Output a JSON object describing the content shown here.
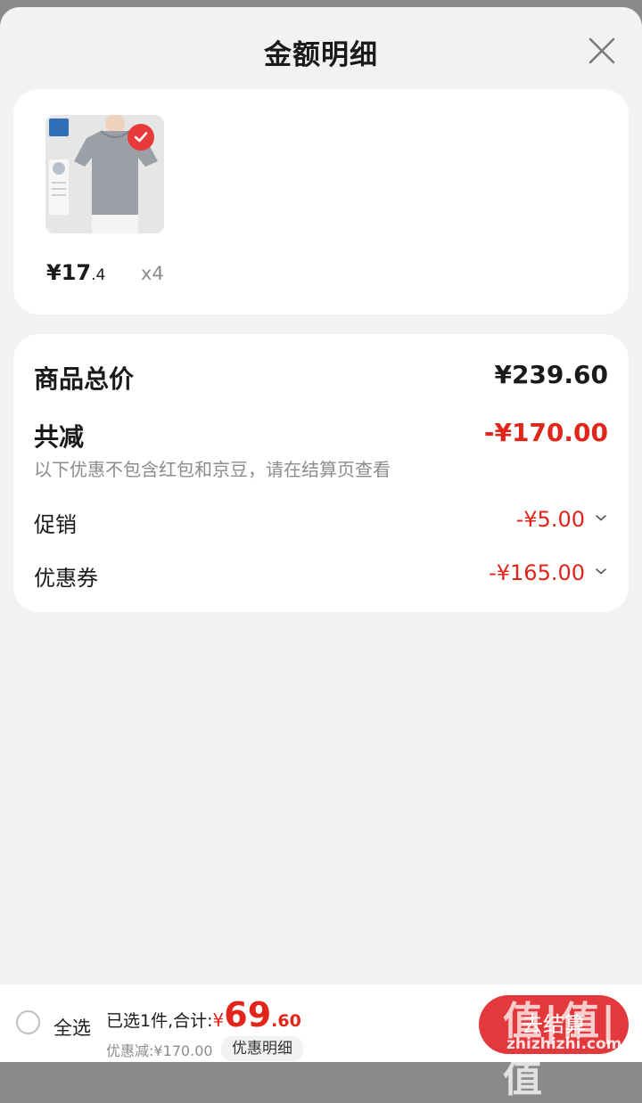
{
  "sheet": {
    "title": "金额明细",
    "close_icon": "close-icon"
  },
  "item": {
    "price_int": "¥17",
    "price_dec": ".4",
    "quantity": "x4",
    "thumbnail_icon": "product-thumbnail-tshirt",
    "selected": true
  },
  "detail": {
    "total_label": "商品总价",
    "total_value": "¥239.60",
    "reduce_label": "共减",
    "reduce_value": "-¥170.00",
    "note": "以下优惠不包含红包和京豆，请在结算页查看",
    "promo_label": "促销",
    "promo_value": "-¥5.00",
    "coupon_label": "优惠券",
    "coupon_value": "-¥165.00"
  },
  "bottom": {
    "select_all": "全选",
    "selected_text": "已选1件,合计:",
    "yen": "¥",
    "total_int": "69",
    "total_dec": ".60",
    "discount_text": "优惠减:¥170.00",
    "detail_button": "优惠明细",
    "checkout_button": "去结算"
  },
  "watermark": {
    "big": "值|值|值",
    "small": "zhizhizhi.com"
  },
  "colors": {
    "accent_red": "#e1251b",
    "checkout_red": "#e4393c",
    "background": "#f2f2f2"
  }
}
